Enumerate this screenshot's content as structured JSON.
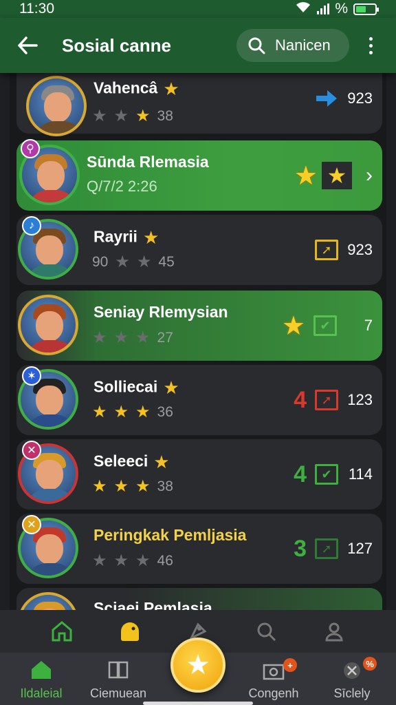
{
  "status": {
    "time": "11:30",
    "battery": "%"
  },
  "appbar": {
    "title": "Sosial canne",
    "search_label": "Nanicen"
  },
  "colors": {
    "accent": "#3e9e3f",
    "gold": "#f5c31d",
    "red": "#d9392c",
    "blue": "#2a8ee0"
  },
  "rows": [
    {
      "name": "Vahencâ",
      "sub_text": "38",
      "stars": 1,
      "count": "923",
      "icon": "arrow-right-icon"
    },
    {
      "name": "Sūnda Rlemasia",
      "sub_text": "Q/7/2 2:26",
      "icon": "star-icon"
    },
    {
      "name": "Rayrii",
      "sub_prefix": "90",
      "sub_text": "45",
      "stars": 0,
      "count": "923",
      "icon": "share-icon"
    },
    {
      "name": "Seniay Rlemysian",
      "sub_text": "27",
      "count": "7",
      "icon": "check-icon"
    },
    {
      "name": "Solliecai",
      "sub_text": "36",
      "stars": 3,
      "rank": "4",
      "count": "123",
      "icon": "share-icon"
    },
    {
      "name": "Seleeci",
      "sub_text": "38",
      "stars": 3,
      "rank": "4",
      "count": "114",
      "icon": "check-icon"
    },
    {
      "name": "Peringkak Pemljasia",
      "sub_text": "46",
      "stars": 0,
      "rank": "3",
      "count": "127",
      "icon": "share-icon"
    },
    {
      "name": "Sciaei Pemlasia"
    }
  ],
  "bottom_nav": {
    "tabs": [
      {
        "label": "Ildaleial"
      },
      {
        "label": "Ciemuean"
      },
      {
        "label": "Congenh",
        "badge": "+"
      },
      {
        "label": "Sīclely",
        "badge": "%"
      }
    ]
  }
}
